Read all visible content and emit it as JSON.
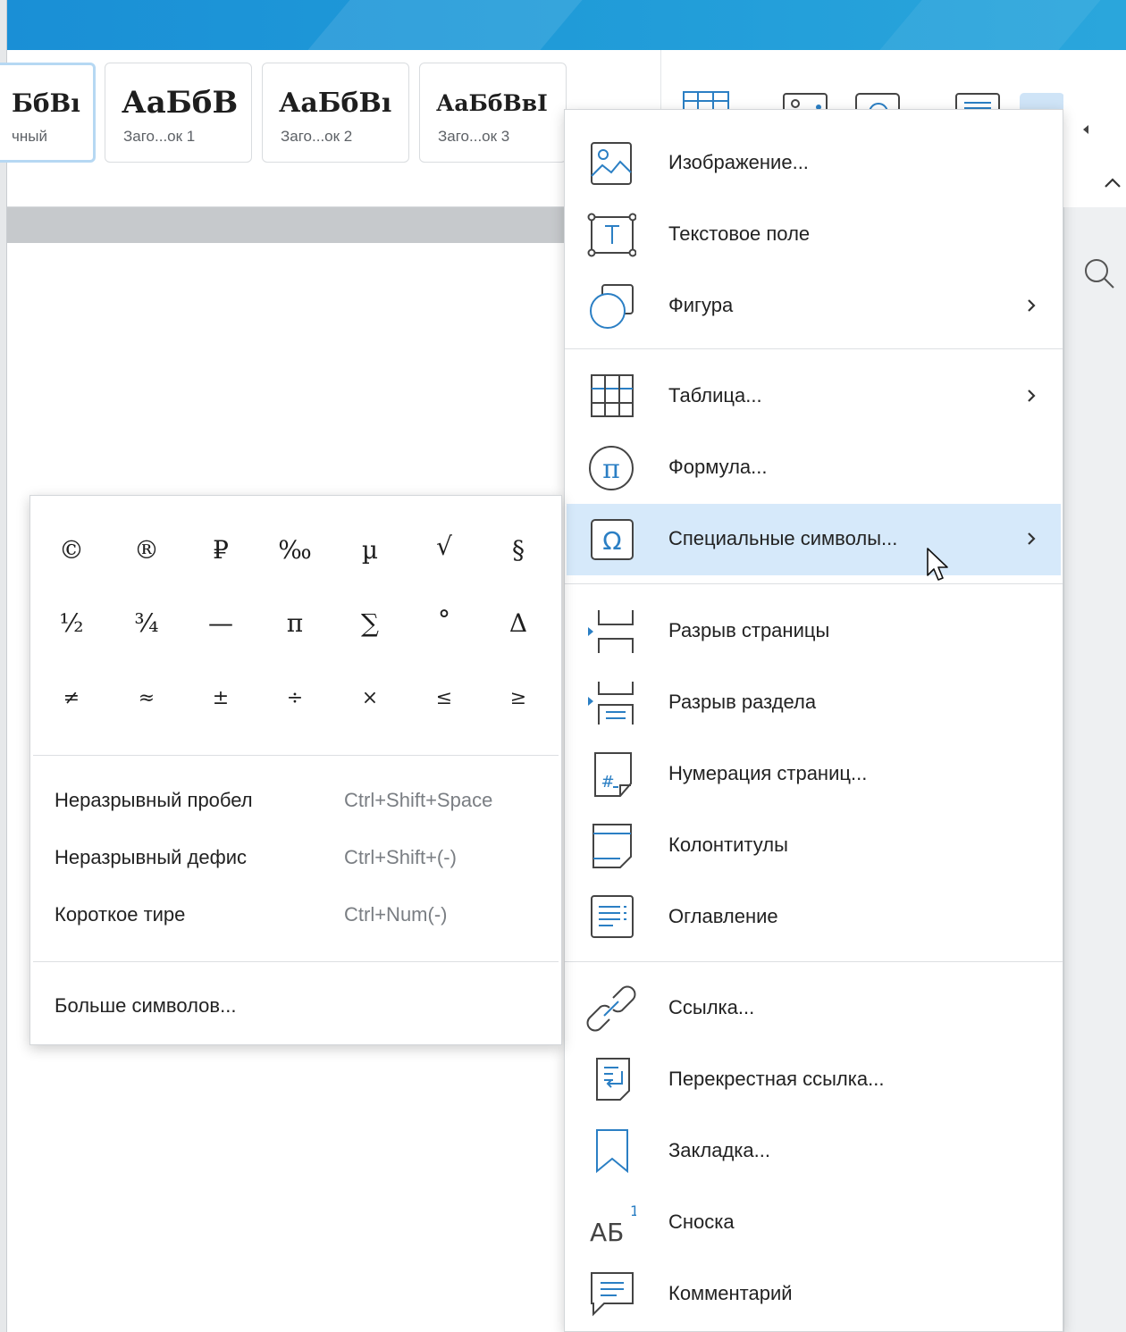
{
  "colors": {
    "accent": "#1a8fd6",
    "icon_blue": "#2b7fc4",
    "highlight": "#d6e9fa"
  },
  "style_gallery": [
    {
      "sample": "БбВı",
      "caption": "чный"
    },
    {
      "sample": "АаБбВ",
      "caption": "Заго...ок 1"
    },
    {
      "sample": "АаБбВı",
      "caption": "Заго...ок 2"
    },
    {
      "sample": "АаБбВвІ",
      "caption": "Заго...ок 3"
    }
  ],
  "insert_menu": {
    "items": [
      {
        "label": "Изображение...",
        "icon": "image-icon",
        "submenu": false
      },
      {
        "label": "Текстовое поле",
        "icon": "textbox-icon",
        "submenu": false
      },
      {
        "label": "Фигура",
        "icon": "shape-icon",
        "submenu": true
      },
      {
        "label": "Таблица...",
        "icon": "table-icon",
        "submenu": true
      },
      {
        "label": "Формула...",
        "icon": "formula-pi-icon",
        "submenu": false
      },
      {
        "label": "Специальные символы...",
        "icon": "omega-icon",
        "submenu": true,
        "highlighted": true
      },
      {
        "label": "Разрыв страницы",
        "icon": "page-break-icon",
        "submenu": false
      },
      {
        "label": "Разрыв раздела",
        "icon": "section-break-icon",
        "submenu": false
      },
      {
        "label": "Нумерация страниц...",
        "icon": "page-numbering-icon",
        "submenu": false
      },
      {
        "label": "Колонтитулы",
        "icon": "header-footer-icon",
        "submenu": false
      },
      {
        "label": "Оглавление",
        "icon": "toc-icon",
        "submenu": false
      },
      {
        "label": "Ссылка...",
        "icon": "link-icon",
        "submenu": false
      },
      {
        "label": "Перекрестная ссылка...",
        "icon": "cross-reference-icon",
        "submenu": false
      },
      {
        "label": "Закладка...",
        "icon": "bookmark-icon",
        "submenu": false
      },
      {
        "label": "Сноска",
        "icon": "footnote-icon",
        "submenu": false
      },
      {
        "label": "Комментарий",
        "icon": "comment-icon",
        "submenu": false
      }
    ]
  },
  "special_symbols": {
    "grid": [
      [
        "©",
        "®",
        "₽",
        "‰",
        "µ",
        "√",
        "§"
      ],
      [
        "½",
        "¾",
        "—",
        "π",
        "∑",
        "°",
        "Δ"
      ],
      [
        "≠",
        "≈",
        "±",
        "÷",
        "×",
        "≤",
        "≥"
      ]
    ],
    "items": [
      {
        "label": "Неразрывный пробел",
        "shortcut": "Ctrl+Shift+Space"
      },
      {
        "label": "Неразрывный дефис",
        "shortcut": "Ctrl+Shift+(-)"
      },
      {
        "label": "Короткое тире",
        "shortcut": "Ctrl+Num(-)"
      }
    ],
    "more": "Больше символов..."
  },
  "footnote_icon_text": {
    "letters": "АБ",
    "sup": "1"
  }
}
